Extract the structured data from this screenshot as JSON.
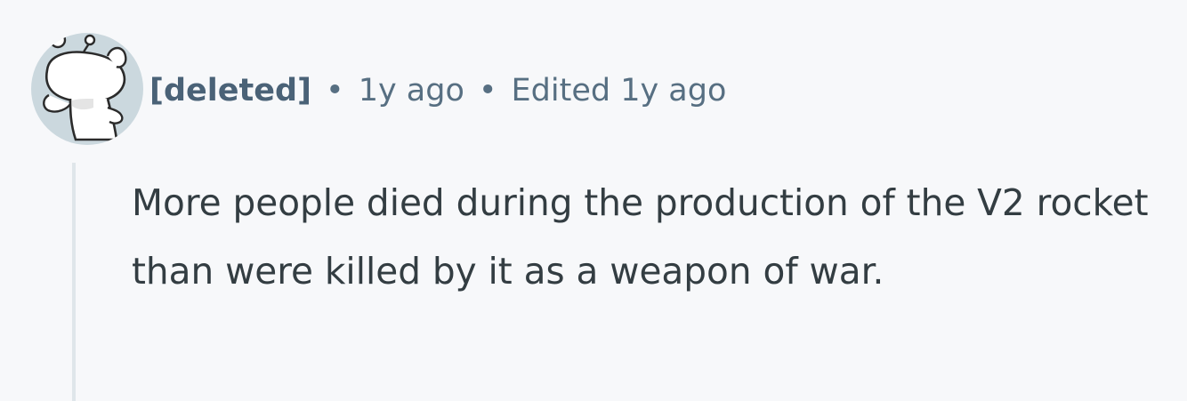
{
  "comment": {
    "author": "[deleted]",
    "separator": "•",
    "time_posted": "1y ago",
    "edited": "Edited 1y ago",
    "body": "More people died during the production of the V2 rocket than were killed by it as a weapon of war."
  },
  "avatar": {
    "icon": "snoo-deleted-icon",
    "background": "#cbd8de"
  },
  "colors": {
    "page_background": "#f7f8fa",
    "author": "#4a6277",
    "meta": "#576f82",
    "body": "#333d42",
    "thread_line": "#dfe6ea"
  }
}
